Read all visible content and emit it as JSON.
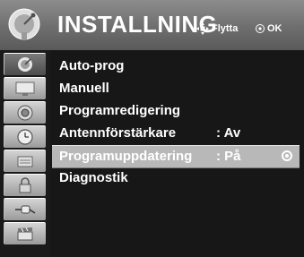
{
  "header": {
    "title": "INSTALLNING",
    "move_hint": "Flytta",
    "ok_hint": "OK",
    "icon": "satellite-dish-icon"
  },
  "sidebar": {
    "items": [
      {
        "icon": "satellite-dish-icon",
        "active": true
      },
      {
        "icon": "tv-screen-icon",
        "active": false
      },
      {
        "icon": "speaker-icon",
        "active": false
      },
      {
        "icon": "clock-icon",
        "active": false
      },
      {
        "icon": "key-lock-icon",
        "active": false
      },
      {
        "icon": "padlock-icon",
        "active": false
      },
      {
        "icon": "plug-icon",
        "active": false
      },
      {
        "icon": "film-clapper-icon",
        "active": false
      }
    ]
  },
  "menu": {
    "items": [
      {
        "label": "Auto-prog",
        "value": ""
      },
      {
        "label": "Manuell",
        "value": ""
      },
      {
        "label": "Programredigering",
        "value": ""
      },
      {
        "label": "Antennförstärkare",
        "value": ": Av"
      },
      {
        "label": "Programuppdatering",
        "value": ": På",
        "selected": true
      },
      {
        "label": "Diagnostik",
        "value": ""
      }
    ]
  }
}
